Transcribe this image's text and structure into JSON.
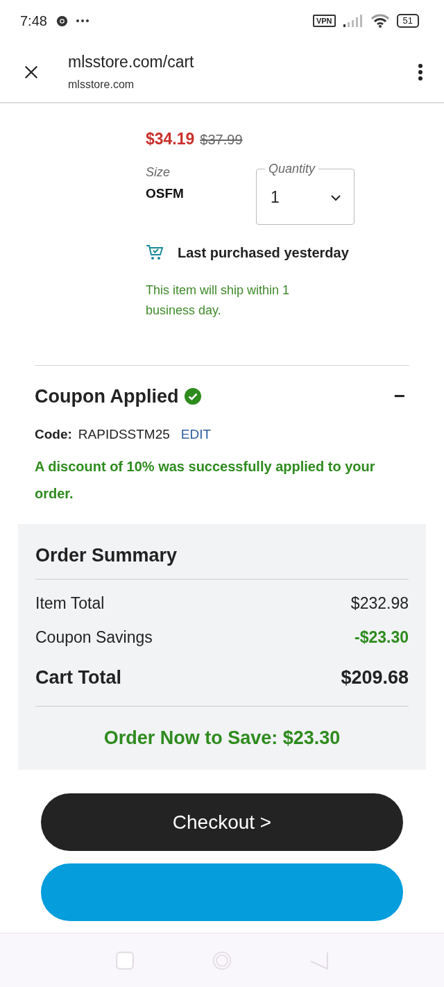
{
  "status_bar": {
    "time": "7:48",
    "vpn": "VPN",
    "battery": "51"
  },
  "browser": {
    "url": "mlsstore.com/cart",
    "domain": "mlsstore.com"
  },
  "item": {
    "price": "$34.19",
    "original_price": "$37.99",
    "size_label": "Size",
    "size": "OSFM",
    "quantity_label": "Quantity",
    "quantity": "1",
    "last_purchased": "Last purchased yesterday",
    "shipping": "This item will ship within 1 business day."
  },
  "coupon": {
    "title": "Coupon Applied",
    "toggle": "−",
    "code_label": "Code:",
    "code": "RAPIDSSTM25",
    "edit": "EDIT",
    "message": "A discount of 10% was successfully applied to your order."
  },
  "summary": {
    "title": "Order Summary",
    "rows": [
      {
        "label": "Item Total",
        "value": "$232.98",
        "kind": "normal"
      },
      {
        "label": "Coupon Savings",
        "value": "-$23.30",
        "kind": "savings"
      },
      {
        "label": "Cart Total",
        "value": "$209.68",
        "kind": "total"
      }
    ],
    "save_message": "Order Now to Save: $23.30"
  },
  "checkout": {
    "label": "Checkout >"
  }
}
